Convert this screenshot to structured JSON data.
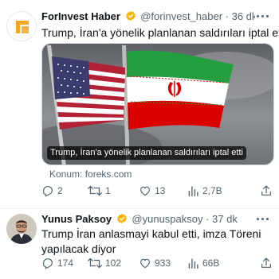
{
  "tweets": [
    {
      "name": "ForInvest Haber",
      "handle": "@forinvest_haber",
      "time": "· 36 dk",
      "text": "Trump, İran'a yönelik planlanan saldırıları iptal etti",
      "media_caption": "Trump, İran'a yönelik planlanan saldırıları iptal etti",
      "source": "Konum: foreks.com",
      "replies": "2",
      "retweets": "1",
      "likes": "13",
      "views": "2,7B"
    },
    {
      "name": "Yunus Paksoy",
      "handle": "@yunuspaksoy",
      "time": "· 37 dk",
      "text": "Trump İran anlasmayi kabul etti, imza Töreni yapılacak diyor",
      "replies": "174",
      "retweets": "102",
      "likes": "933",
      "views": "66B"
    }
  ],
  "colors": {
    "verified": "#f4b400",
    "secondary_text": "#536471",
    "primary_text": "#0f1419",
    "logo_orange": "#f5a623"
  },
  "icons": [
    "verified-badge-icon",
    "more-options-icon",
    "reply-icon",
    "retweet-icon",
    "like-icon",
    "views-icon",
    "share-icon"
  ]
}
